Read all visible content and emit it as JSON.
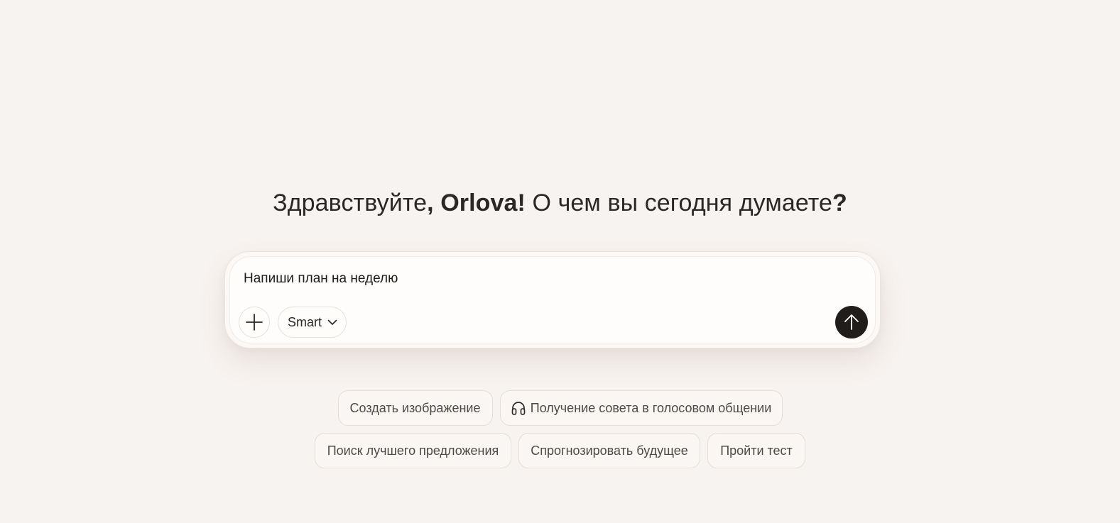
{
  "greeting": {
    "hello": "Здравствуйте",
    "comma": ", ",
    "name": "Orlova!",
    "question": " О чем вы сегодня думаете",
    "question_mark": "?"
  },
  "composer": {
    "input_value": "Напиши план на неделю",
    "mode_label": "Smart"
  },
  "suggestions": {
    "row1": [
      {
        "label": "Создать изображение",
        "icon": null
      },
      {
        "label": "Получение совета в голосовом общении",
        "icon": "headphones-icon"
      }
    ],
    "row2": [
      {
        "label": "Поиск лучшего предложения",
        "icon": null
      },
      {
        "label": "Спрогнозировать будущее",
        "icon": null
      },
      {
        "label": "Пройти тест",
        "icon": null
      }
    ]
  },
  "colors": {
    "background": "#f7f3f0",
    "send_button": "#201d1b",
    "text": "#2b2724"
  }
}
